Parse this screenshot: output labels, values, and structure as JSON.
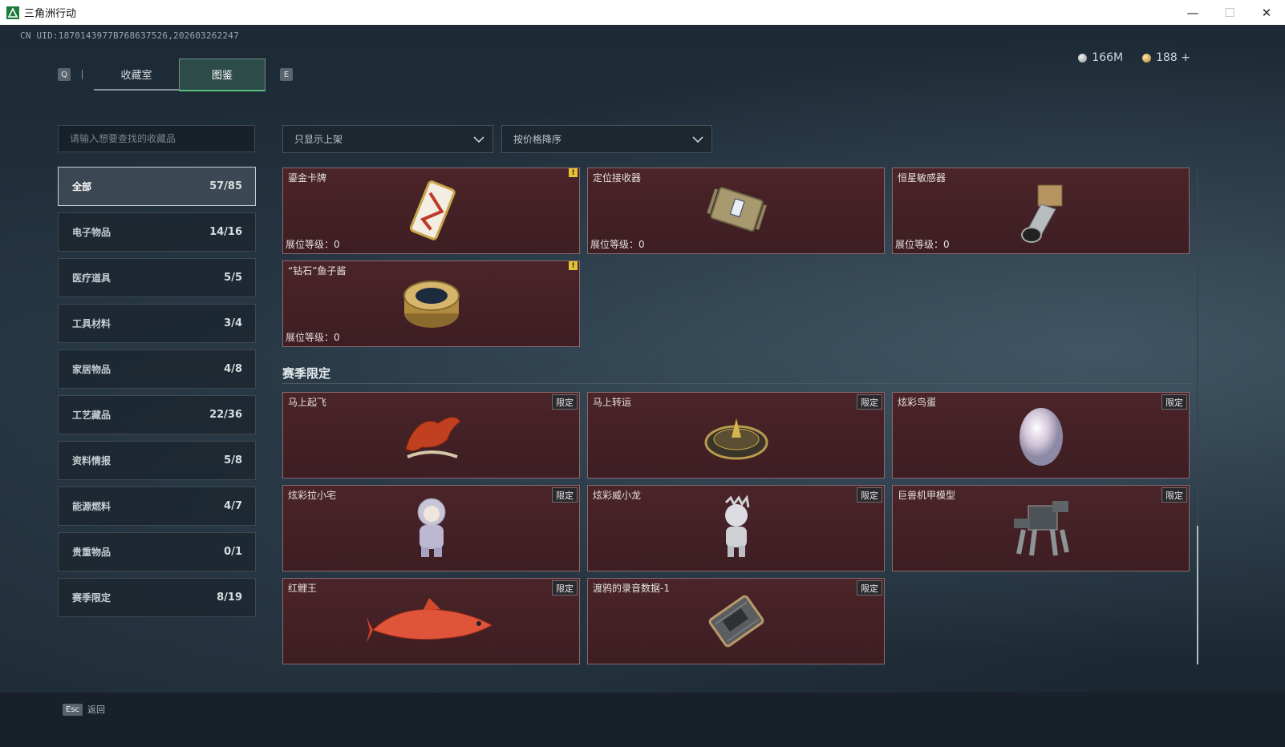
{
  "window": {
    "title": "三角洲行动",
    "controls": [
      "—",
      "☐",
      "✕"
    ]
  },
  "header": {
    "uid": "CN UID:1870143977B768637526,202603262247",
    "currency": [
      {
        "icon": "silver-coin-icon",
        "value": "166M"
      },
      {
        "icon": "gold-coin-icon",
        "value": "188 +"
      }
    ]
  },
  "tabs": {
    "left_key": "Q",
    "right_key": "E",
    "items": [
      {
        "label": "收藏室",
        "active": false
      },
      {
        "label": "图鉴",
        "active": true
      }
    ]
  },
  "search": {
    "placeholder": "请输入想要查找的收藏品",
    "value": ""
  },
  "categories": [
    {
      "label": "全部",
      "count": "57/85",
      "active": true
    },
    {
      "label": "电子物品",
      "count": "14/16"
    },
    {
      "label": "医疗道具",
      "count": "5/5"
    },
    {
      "label": "工具材料",
      "count": "3/4"
    },
    {
      "label": "家居物品",
      "count": "4/8"
    },
    {
      "label": "工艺藏品",
      "count": "22/36"
    },
    {
      "label": "资料情报",
      "count": "5/8"
    },
    {
      "label": "能源燃料",
      "count": "4/7"
    },
    {
      "label": "贵重物品",
      "count": "0/1"
    },
    {
      "label": "赛季限定",
      "count": "8/19"
    }
  ],
  "filters": {
    "shelf": "只显示上架",
    "sort": "按价格降序"
  },
  "items_top": [
    {
      "name": "鎏金卡牌",
      "level": "展位等级：0",
      "warn": "!"
    },
    {
      "name": "定位接收器",
      "level": "展位等级：0"
    },
    {
      "name": "恒星敏感器",
      "level": "展位等级：0"
    },
    {
      "name": "“钻石”鱼子酱",
      "level": "展位等级：0",
      "warn": "!"
    }
  ],
  "section": {
    "title": "赛季限定"
  },
  "items_season": [
    {
      "name": "马上起飞",
      "badge": "限定"
    },
    {
      "name": "马上转运",
      "badge": "限定"
    },
    {
      "name": "炫彩鸟蛋",
      "badge": "限定"
    },
    {
      "name": "炫彩拉小宅",
      "badge": "限定"
    },
    {
      "name": "炫彩威小龙",
      "badge": "限定"
    },
    {
      "name": "巨兽机甲模型",
      "badge": "限定"
    },
    {
      "name": "红鲤王",
      "badge": "限定"
    },
    {
      "name": "渡鸦的录音数据-1",
      "badge": "限定"
    }
  ],
  "footer": {
    "key": "Esc",
    "label": "返回"
  },
  "colors": {
    "card_bg": "#4a2428",
    "accent_green": "#53c07e",
    "warning": "#e5c43a"
  }
}
